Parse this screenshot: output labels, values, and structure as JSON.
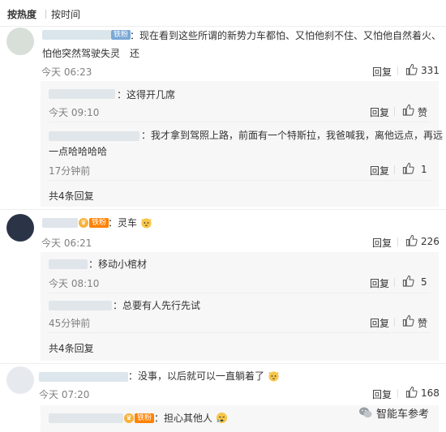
{
  "sort": {
    "hot": "按热度",
    "time": "按时间"
  },
  "comments": [
    {
      "badge": "铁粉",
      "text": "：现在看到这些所谓的新势力车都怕、又怕他刹不住、又怕他自然着火、还",
      "text2": "怕他突然驾驶失灵",
      "time": "今天 06:23",
      "reply_label": "回复",
      "likes": "331",
      "replies": [
        {
          "text": "：这得开几席",
          "time": "今天 09:10",
          "reply_label": "回复",
          "likes": "赞"
        },
        {
          "text": "：我才拿到驾照上路，前面有一个特斯拉，我爸喊我，离他远点，再远",
          "text2": "一点哈哈哈哈",
          "time": "17分钟前",
          "reply_label": "回复",
          "likes": "1"
        }
      ],
      "more": "共4条回复"
    },
    {
      "badge": "铁粉",
      "text": "：灵车",
      "time": "今天 06:21",
      "reply_label": "回复",
      "likes": "226",
      "replies": [
        {
          "text": "：移动小棺材",
          "time": "今天 08:10",
          "reply_label": "回复",
          "likes": "5"
        },
        {
          "text": "：总要有人先行先试",
          "time": "45分钟前",
          "reply_label": "回复",
          "likes": "赞"
        }
      ],
      "more": "共4条回复"
    },
    {
      "text": "：没事，以后就可以一直躺着了",
      "time": "今天 07:20",
      "reply_label": "回复",
      "likes": "168",
      "replies": [
        {
          "badge": "铁粉",
          "text": "：担心其他人"
        }
      ]
    }
  ],
  "watermark": "智能车参考"
}
